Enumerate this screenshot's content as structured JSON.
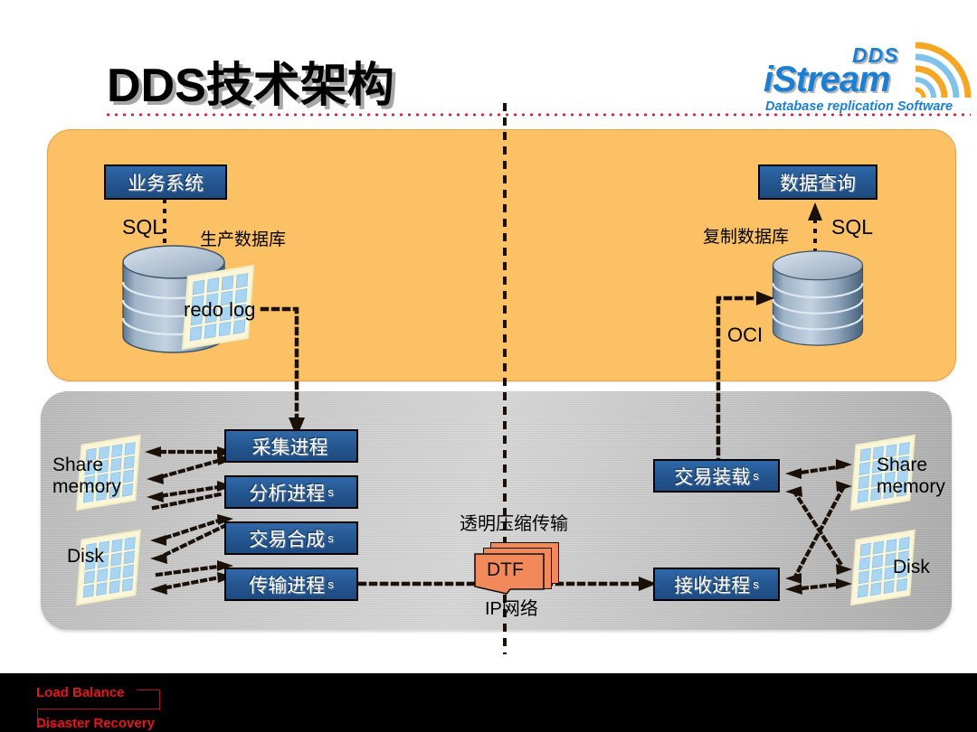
{
  "slide": {
    "title": "DDS技术架构"
  },
  "logo": {
    "dds": "DDS",
    "istream": "iStream",
    "tagline": "Database replication Software",
    "arc_colors": [
      "#f5a623",
      "#7fc3e8",
      "#f5a623",
      "#7fc3e8",
      "#f5a623"
    ]
  },
  "colors": {
    "orange_panel": "#fbc164",
    "orange_panel_border": "#e3a349",
    "box_blue": "#24558f",
    "dtf_orange": "#f2895a",
    "accent_red": "#d2233c",
    "bar_red": "#e8141e"
  },
  "database_layer": {
    "source": {
      "app_box": "业务系统",
      "sql_label": "SQL",
      "db_label": "生产数据库",
      "log_label": "redo log"
    },
    "target": {
      "query_box": "数据查询",
      "sql_label": "SQL",
      "db_label": "复制数据库",
      "oci_label": "OCI"
    }
  },
  "process_layer": {
    "left_storage": [
      {
        "line1": "Share",
        "line2": "memory"
      },
      {
        "line1": "Disk",
        "line2": ""
      }
    ],
    "right_storage": [
      {
        "line1": "Share",
        "line2": "memory"
      },
      {
        "line1": "Disk",
        "line2": ""
      }
    ],
    "source_processes": [
      {
        "label": "采集进程",
        "suffix": ""
      },
      {
        "label": "分析进程",
        "suffix": "s"
      },
      {
        "label": "交易合成",
        "suffix": "s"
      },
      {
        "label": "传输进程",
        "suffix": "s"
      }
    ],
    "target_processes": [
      {
        "label": "交易装载",
        "suffix": "s"
      },
      {
        "label": "接收进程",
        "suffix": "s"
      }
    ],
    "transport": {
      "top_label": "透明压缩传输",
      "card_label": "DTF",
      "bottom_label": "IP网络"
    }
  },
  "footer": {
    "load_balance": "Load Balance",
    "disaster_recovery": "Disaster Recovery"
  }
}
